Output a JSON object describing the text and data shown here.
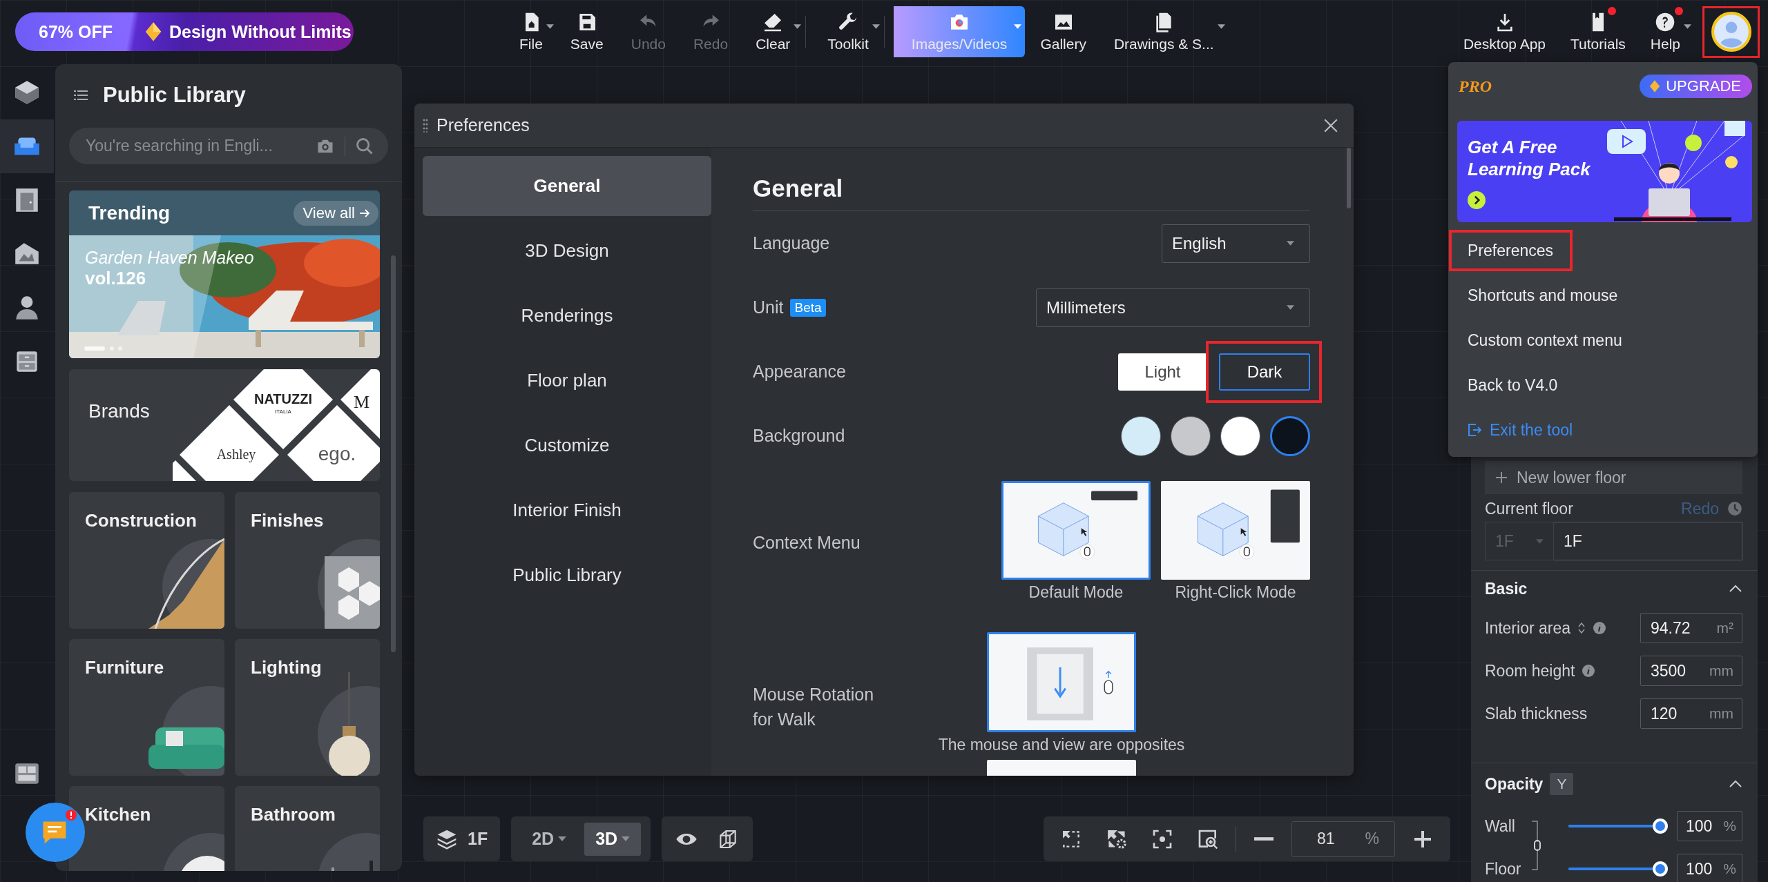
{
  "promo": {
    "discount": "67% OFF",
    "slogan": "Design Without Limits"
  },
  "toolbar": [
    {
      "label": "File",
      "separated": false,
      "disabled": false,
      "dropdown": true,
      "selected": false
    },
    {
      "label": "Save",
      "separated": false,
      "disabled": false,
      "dropdown": false,
      "selected": false
    },
    {
      "label": "Undo",
      "separated": false,
      "disabled": true,
      "dropdown": false,
      "selected": false
    },
    {
      "label": "Redo",
      "separated": false,
      "disabled": true,
      "dropdown": false,
      "selected": false
    },
    {
      "label": "Clear",
      "separated": false,
      "disabled": false,
      "dropdown": true,
      "selected": false
    },
    {
      "label": "Toolkit",
      "separated": true,
      "disabled": false,
      "dropdown": true,
      "selected": false
    },
    {
      "label": "Images/Videos",
      "separated": true,
      "disabled": false,
      "dropdown": true,
      "selected": true
    },
    {
      "label": "Gallery",
      "separated": false,
      "disabled": false,
      "dropdown": false,
      "selected": false
    },
    {
      "label": "Drawings & S...",
      "separated": false,
      "disabled": false,
      "dropdown": true,
      "selected": false
    }
  ],
  "toolbar_right": [
    {
      "label": "Desktop App",
      "badge": false,
      "dropdown": false
    },
    {
      "label": "Tutorials",
      "badge": true,
      "dropdown": false
    },
    {
      "label": "Help",
      "badge": true,
      "dropdown": true
    }
  ],
  "account": {
    "highlighted": true
  },
  "rail": [
    {
      "selected": false
    },
    {
      "selected": true
    },
    {
      "selected": false
    },
    {
      "selected": false
    },
    {
      "selected": false
    },
    {
      "selected": false
    },
    {
      "selected": false
    }
  ],
  "library": {
    "title": "Public Library",
    "search": {
      "placeholder": "You're searching in Engli..."
    },
    "trending": {
      "title": "Trending",
      "link": "View all",
      "caption": "Garden Haven Makeo",
      "issue": "vol.126"
    },
    "brands": {
      "title": "Brands",
      "logos": [
        "NATUZZI",
        "ITALIA",
        "M",
        "Ashley",
        "ego."
      ]
    },
    "categories": [
      "Construction",
      "Finishes",
      "Furniture",
      "Lighting",
      "Kitchen",
      "Bathroom"
    ]
  },
  "dialog": {
    "title": "Preferences",
    "nav": [
      {
        "label": "General",
        "selected": true
      },
      {
        "label": "3D Design",
        "selected": false
      },
      {
        "label": "Renderings",
        "selected": false
      },
      {
        "label": "Floor plan",
        "selected": false
      },
      {
        "label": "Customize",
        "selected": false
      },
      {
        "label": "Interior Finish",
        "selected": false
      },
      {
        "label": "Public Library",
        "selected": false
      }
    ],
    "heading": "General",
    "language": {
      "label": "Language",
      "value": "English"
    },
    "unit": {
      "label": "Unit",
      "badge": "Beta",
      "value": "Millimeters"
    },
    "appearance": {
      "label": "Appearance",
      "options": [
        {
          "label": "Light",
          "selected": false,
          "highlighted": false
        },
        {
          "label": "Dark",
          "selected": true,
          "highlighted": true
        }
      ]
    },
    "background": {
      "label": "Background",
      "swatches": [
        {
          "color": "#d3ecf7",
          "selected": false
        },
        {
          "color": "#c6c8cc",
          "selected": false
        },
        {
          "color": "#ffffff",
          "selected": false
        },
        {
          "color": "#0c131d",
          "selected": true
        }
      ]
    },
    "context_menu": {
      "label": "Context Menu",
      "options": [
        {
          "label": "Default Mode",
          "selected": true
        },
        {
          "label": "Right-Click Mode",
          "selected": false
        }
      ]
    },
    "mouse_rotation": {
      "label": "Mouse Rotation for Walk",
      "options": [
        {
          "label": "The mouse and view are opposites",
          "selected": true
        },
        {
          "selected": false
        }
      ]
    }
  },
  "user_menu": {
    "plan": "PRO",
    "upgrade": "UPGRADE",
    "banner": "Get A Free Learning Pack",
    "items": [
      {
        "label": "Preferences",
        "kind": "item",
        "highlighted": true
      },
      {
        "label": "Shortcuts and mouse",
        "kind": "item",
        "highlighted": false
      },
      {
        "label": "Custom context menu",
        "kind": "item",
        "highlighted": false
      },
      {
        "label": "Back to V4.0",
        "kind": "item",
        "highlighted": false
      },
      {
        "label": "Exit the tool",
        "kind": "exit",
        "highlighted": false
      }
    ]
  },
  "properties": {
    "new_floor": "New lower floor",
    "current_floor": {
      "label": "Current floor",
      "action": "Redo",
      "action_disabled": true,
      "select": "1F",
      "value": "1F"
    },
    "basic": {
      "title": "Basic",
      "expanded": true,
      "fields": [
        {
          "label": "Interior area",
          "sortable": true,
          "info": true,
          "value": "94.72",
          "unit": "m²"
        },
        {
          "label": "Room height",
          "sortable": false,
          "info": true,
          "value": "3500",
          "unit": "mm"
        },
        {
          "label": "Slab thickness",
          "sortable": false,
          "info": false,
          "value": "120",
          "unit": "mm"
        }
      ]
    },
    "opacity": {
      "title": "Opacity",
      "key": "Y",
      "expanded": true,
      "sliders": [
        {
          "label": "Wall",
          "level": 1,
          "reading": "100",
          "unit": "%"
        },
        {
          "label": "Floor",
          "level": 1,
          "reading": "100",
          "unit": "%"
        }
      ]
    }
  },
  "bottom": {
    "floor": "1F",
    "views": [
      {
        "label": "2D",
        "selected": false
      },
      {
        "label": "3D",
        "selected": true
      }
    ],
    "zoom": "81",
    "zoom_unit": "%"
  },
  "chat": {
    "badge": true
  }
}
